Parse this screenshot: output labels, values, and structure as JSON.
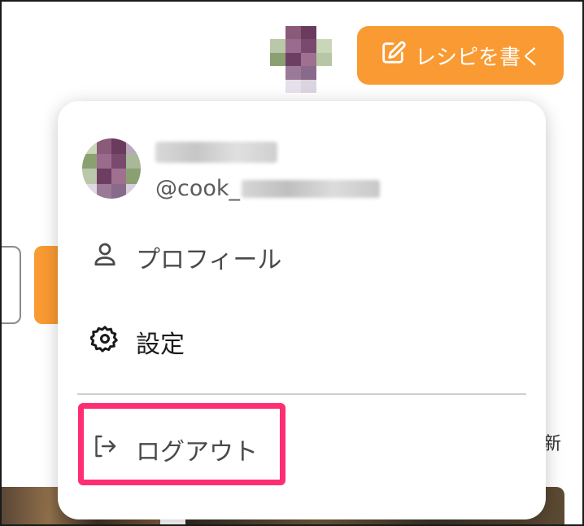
{
  "header": {
    "write_recipe_label": "レシピを書く",
    "write_recipe_icon": "edit-icon",
    "accent_color": "#f99a32"
  },
  "user_menu": {
    "handle_prefix": "@cook_",
    "items": [
      {
        "label": "プロフィール",
        "icon": "user-icon"
      },
      {
        "label": "設定",
        "icon": "gear-icon"
      },
      {
        "label": "ログアウト",
        "icon": "logout-icon"
      }
    ],
    "highlight_color": "#ff2e72"
  },
  "background": {
    "side_text": "新"
  }
}
